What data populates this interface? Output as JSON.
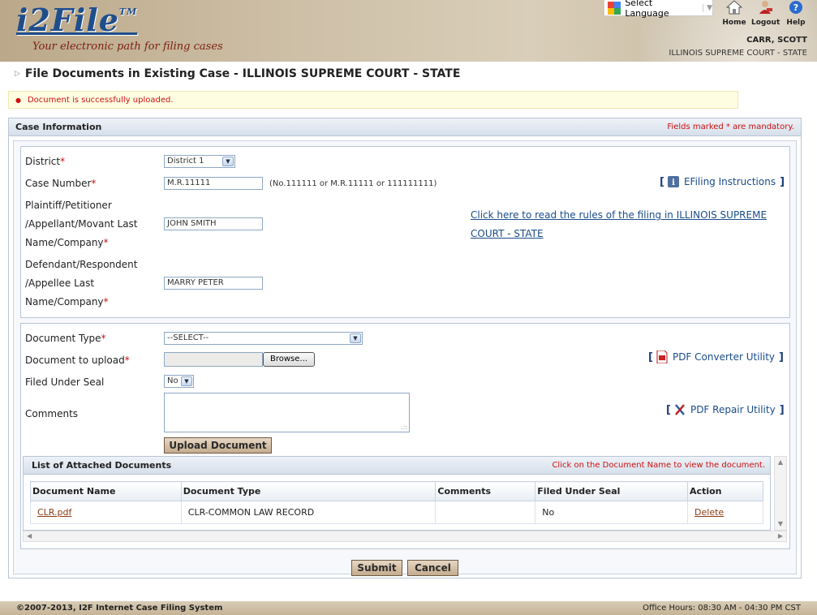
{
  "header": {
    "logo": "i2File",
    "logo_tm": "TM",
    "tagline": "Your electronic path for filing cases",
    "language_label": "Select Language",
    "nav": [
      {
        "label": "Home",
        "icon": "home-icon"
      },
      {
        "label": "Logout",
        "icon": "logout-icon"
      },
      {
        "label": "Help",
        "icon": "help-icon"
      }
    ],
    "user_name": "CARR, SCOTT",
    "user_court": "ILLINOIS SUPREME COURT - STATE"
  },
  "page": {
    "title": "File Documents in Existing Case - ILLINOIS SUPREME COURT - STATE",
    "message": "Document is successfully uploaded."
  },
  "case_info": {
    "title": "Case Information",
    "mandatory_note": "Fields marked * are mandatory.",
    "required_marker": "*",
    "district_label": "District",
    "district_value": "District 1",
    "case_number_label": "Case Number",
    "case_number_value": "M.R.11111",
    "case_number_hint": "(No.111111 or M.R.11111 or 111111111)",
    "efiling_label": "EFiling Instructions",
    "plaintiff_label_lines": [
      "Plaintiff/Petitioner",
      "/Appellant/Movant Last",
      "Name/Company"
    ],
    "plaintiff_value": "JOHN SMITH",
    "rules_link_lines": [
      "Click here to read the rules of the filing in ILLINOIS SUPREME",
      "COURT - STATE"
    ],
    "defendant_label_lines": [
      "Defendant/Respondent",
      "/Appellee Last",
      "Name/Company"
    ],
    "defendant_value": "MARRY PETER"
  },
  "document": {
    "type_label": "Document Type",
    "type_value": "--SELECT--",
    "upload_label": "Document to upload",
    "browse_label": "Browse...",
    "pdf_converter_label": "PDF Converter Utility",
    "seal_label": "Filed Under Seal",
    "seal_value": "No",
    "comments_label": "Comments",
    "pdf_repair_label": "PDF Repair Utility",
    "upload_button": "Upload Document"
  },
  "attached": {
    "title": "List of Attached Documents",
    "note": "Click on the Document Name to view the document.",
    "columns": [
      "Document Name",
      "Document Type",
      "Comments",
      "Filed Under Seal",
      "Action"
    ],
    "rows": [
      {
        "name": "CLR.pdf",
        "type": "CLR-COMMON LAW RECORD",
        "comments": "",
        "seal": "No",
        "action": "Delete"
      }
    ]
  },
  "actions": {
    "submit": "Submit",
    "cancel": "Cancel"
  },
  "footer": {
    "copyright": "©2007-2013, I2F Internet Case Filing System",
    "hours": "Office Hours: 08:30 AM - 04:30 PM CST"
  },
  "colors": {
    "brand_blue": "#1f4e8c",
    "required_red": "#cc1111",
    "header_tan": "#c9b99d"
  }
}
